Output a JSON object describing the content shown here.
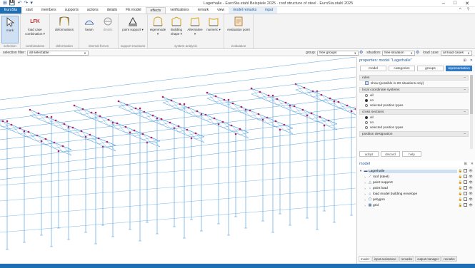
{
  "window": {
    "title": "Lagerhalle - EuroSta.stahl Beispiele 2025 · roof structure of steel · EuroSta.stahl 2025",
    "minimize": "–",
    "maximize": "□",
    "close": "✕"
  },
  "quick_access": [
    "⊞",
    "💾",
    "↶",
    "↷",
    "▾"
  ],
  "tabs": {
    "file": "EuroSta",
    "items": [
      "start",
      "members",
      "supports",
      "actions",
      "details",
      "FE model",
      "effects",
      "verifications",
      "remark",
      "view",
      "model remarks",
      "input"
    ],
    "active": "effects",
    "right": [
      "^",
      "?"
    ]
  },
  "ribbon": {
    "groups": [
      {
        "name": "selection",
        "buttons": [
          {
            "label": "mark",
            "icon": "pointer-icon",
            "selected": true
          }
        ]
      },
      {
        "name": "combinations",
        "buttons": [
          {
            "label": "load case combination ▾",
            "icon": "lfk-icon",
            "icon_text": "LFK"
          }
        ]
      },
      {
        "name": "deformation",
        "buttons": [
          {
            "label": "deformations",
            "icon": "deformation-icon"
          }
        ]
      },
      {
        "name": "internal forces",
        "buttons": [
          {
            "label": "beam",
            "icon": "beam-forces-icon"
          },
          {
            "label": "details",
            "icon": "details-forces-icon",
            "dim": true
          }
        ]
      },
      {
        "name": "support reactions",
        "buttons": [
          {
            "label": "point support ▾",
            "icon": "point-support-icon"
          }
        ]
      },
      {
        "name": "system analysis",
        "buttons": [
          {
            "label": "eigenmode ▾",
            "icon": "eigenmode-icon"
          },
          {
            "label": "Building shape ▾",
            "icon": "building-shape-icon"
          },
          {
            "label": "Alternative ▾",
            "icon": "alternative-icon"
          },
          {
            "label": "numeric ▾",
            "icon": "numeric-icon"
          }
        ]
      },
      {
        "name": "evaluation",
        "buttons": [
          {
            "label": "evaluation point",
            "icon": "evaluation-point-icon"
          }
        ]
      }
    ]
  },
  "filterbar": {
    "selection_filter_label": "selection filter:",
    "selection_filter_value": "all selectable",
    "group_label": "group:",
    "group_value": "free groups",
    "situation_label": "situation:",
    "situation_value": "free situation",
    "load_case_label": "load case:",
    "load_case_value": "all load cases"
  },
  "properties": {
    "title": "properties: model \"Lagerhalle\"",
    "pin": "⊞",
    "close": "✕",
    "tabs": [
      "model",
      "categories",
      "groups",
      "representation"
    ],
    "active_tab": "representation",
    "sections": [
      {
        "title": "rules",
        "rows": [
          {
            "type": "check",
            "label": "show (possible in 2D situations only)"
          }
        ]
      },
      {
        "title": "local coordinate systems",
        "rows": [
          {
            "type": "radio",
            "label": "all",
            "on": false
          },
          {
            "type": "radio",
            "label": "no",
            "on": true
          },
          {
            "type": "radio",
            "label": "selected position types",
            "on": false
          }
        ]
      },
      {
        "title": "cross sections",
        "rows": [
          {
            "type": "radio",
            "label": "all",
            "on": true
          },
          {
            "type": "radio",
            "label": "no",
            "on": false
          },
          {
            "type": "radio",
            "label": "selected position types",
            "on": false
          }
        ]
      },
      {
        "title": "position designation",
        "rows": []
      }
    ],
    "buttons": [
      "adopt",
      "discard",
      "help"
    ]
  },
  "model_tree": {
    "title": "model",
    "pin": "⊞",
    "close": "✕",
    "items": [
      {
        "label": "Lagerhalle",
        "level": 0,
        "icon": "folder-icon",
        "expand": "▾"
      },
      {
        "label": "roof (steel)",
        "level": 1,
        "icon": "steel-icon",
        "expand": "›"
      },
      {
        "label": "point support",
        "level": 1,
        "icon": "support-icon",
        "expand": "›"
      },
      {
        "label": "point load",
        "level": 1,
        "icon": "point-load-icon",
        "expand": "›"
      },
      {
        "label": "load model building envelope",
        "level": 1,
        "icon": "envelope-icon",
        "expand": "›"
      },
      {
        "label": "polygon",
        "level": 1,
        "icon": "polygon-icon",
        "expand": "›"
      },
      {
        "label": "grid",
        "level": 1,
        "icon": "grid-icon",
        "expand": "›"
      }
    ]
  },
  "bottom_tabs": [
    "model",
    "input assistance",
    "remarks",
    "output manager",
    "remarks"
  ],
  "bottom_active": "model",
  "colors": {
    "accent": "#1f6fb5",
    "structure": "#5aa5e0",
    "node": "#c2185b",
    "status_bar": "#1f6fb5"
  }
}
